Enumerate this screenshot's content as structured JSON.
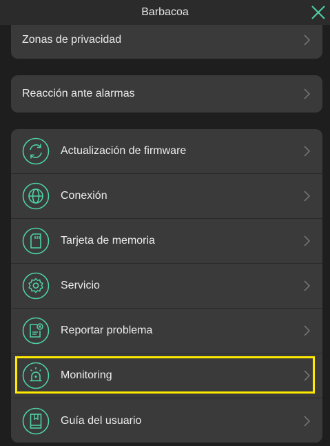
{
  "header": {
    "title": "Barbacoa",
    "close_icon": "close-icon"
  },
  "colors": {
    "accent": "#4fd1a5",
    "background": "#1e1e1e",
    "card": "#3a3a3a",
    "highlight": "#ffea00"
  },
  "sections": {
    "privacy": {
      "label": "Zonas de privacidad"
    },
    "alarm": {
      "label": "Reacción ante alarmas"
    },
    "main_items": [
      {
        "label": "Actualización de firmware",
        "icon": "firmware-update-icon"
      },
      {
        "label": "Conexión",
        "icon": "globe-icon"
      },
      {
        "label": "Tarjeta de memoria",
        "icon": "memory-card-icon"
      },
      {
        "label": "Servicio",
        "icon": "gear-icon"
      },
      {
        "label": "Reportar problema",
        "icon": "report-problem-icon"
      },
      {
        "label": "Monitoring",
        "icon": "siren-icon"
      },
      {
        "label": "Guía del usuario",
        "icon": "user-guide-icon"
      }
    ]
  }
}
